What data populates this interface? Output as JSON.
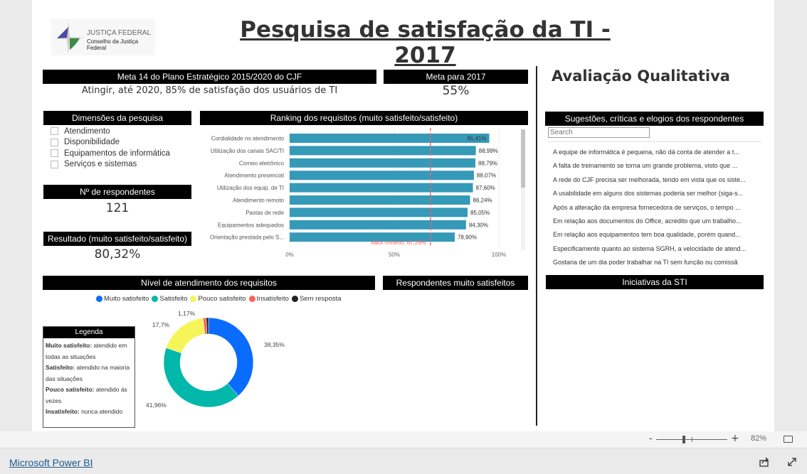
{
  "report": {
    "logo": {
      "line1": "JUSTIÇA FEDERAL",
      "line2": "Conselho da Justiça Federal"
    },
    "title": "Pesquisa de satisfação da TI - 2017",
    "meta14": {
      "header": "Meta 14 do Plano Estratégico  2015/2020 do CJF",
      "text": "Atingir, até 2020, 85% de satisfação dos usuários de TI"
    },
    "meta2017": {
      "header": "Meta para 2017",
      "value": "55%"
    },
    "dimensoes": {
      "header": "Dimensões da pesquisa",
      "items": [
        "Atendimento",
        "Disponibilidade",
        "Equipamentos de informática",
        "Serviços e sistemas"
      ]
    },
    "respondentes": {
      "header": "Nº de respondentes",
      "value": "121"
    },
    "resultado": {
      "header": "Resultado (muito satisfeito/satisfeito)",
      "value": "80,32%"
    },
    "ranking_header": "Ranking dos requisitos (muito satisfeito/satisfeito)",
    "nivel_header": "Nível de atendimento dos requisitos",
    "muito_satisfeitos_header": "Respondentes muito satisfeitos",
    "legenda": {
      "header": "Legenda",
      "items": [
        {
          "term": "Muito satisfeito:",
          "desc": " atendido em todas as situações"
        },
        {
          "term": "Satisfeito:",
          "desc": " atendido na maioria das situações"
        },
        {
          "term": "Pouco satisfeito:",
          "desc": " atendido ás vezes"
        },
        {
          "term": "Insatisfeito:",
          "desc": " nunca atendido"
        }
      ]
    },
    "qualitativa": {
      "title": "Avaliação Qualitativa",
      "header": "Sugestões, críticas e elogios dos respondentes",
      "search_placeholder": "Search",
      "comments": [
        "A equipe de informática é pequena, não dá conta de atender a t...",
        "A falta de treinamento se torna um grande problema, visto que ...",
        "A rede do CJF precisa ser melhorada, tendo em vista que os siste...",
        "A usabilidade em alguns dos sistemas poderia ser melhor (siga-s...",
        "Após a alteração da empresa fornecedora de serviços, o tempo ...",
        "Em relação aos documentos do Office, acredito que um trabalho...",
        "Em relação aos equipamentos tem boa qualidade, porém quand...",
        "Especificamente quanto ao sistema SGRH, a velocidade de atend...",
        "Gostaria de um dia poder trabalhar na TI sem função ou comissã"
      ]
    },
    "iniciativas_header": "Iniciativas da STI"
  },
  "chart_data": [
    {
      "type": "bar",
      "orientation": "horizontal",
      "categories": [
        "Cordialidade no atendimento",
        "Utilização dos canais SAC/TI",
        "Correio eletrônico",
        "Atendimento presencial",
        "Utilização dos equip. de TI",
        "Atendimento remoto",
        "Pastas de rede",
        "Equipamentos adequados",
        "Orientação prestada pelo S..."
      ],
      "values": [
        95.41,
        88.99,
        88.79,
        88.07,
        87.6,
        86.24,
        85.05,
        84.3,
        78.9
      ],
      "labels": [
        "95,41%",
        "88,99%",
        "88,79%",
        "88,07%",
        "87,60%",
        "86,24%",
        "85,05%",
        "84,30%",
        "78,90%"
      ],
      "xlim": [
        0,
        100
      ],
      "xticks": [
        "0%",
        "50%",
        "100%"
      ],
      "reference_line": {
        "value": 67.29,
        "label": "Valor mínimo: 67,29%",
        "color": "#fd625e"
      },
      "bar_color": "#3599b8",
      "grid": true
    },
    {
      "type": "pie",
      "donut": true,
      "series": [
        {
          "name": "Muito satisfeito",
          "value": 38.35,
          "label": "38,35%",
          "color": "#0a6cff"
        },
        {
          "name": "Satisfeito",
          "value": 41.96,
          "label": "41,96%",
          "color": "#01b8aa"
        },
        {
          "name": "Pouco satisfeito",
          "value": 17.7,
          "label": "17,7%",
          "color": "#f5f55a"
        },
        {
          "name": "Insatisfeito",
          "value": 1.17,
          "label": "1,17%",
          "color": "#fd625e"
        },
        {
          "name": "Sem resposta",
          "value": 0.82,
          "label": "",
          "color": "#222222"
        }
      ],
      "legend": "top"
    }
  ],
  "footer": {
    "brand": "Microsoft Power BI",
    "zoom": "82%",
    "zoom_minus": "-",
    "zoom_plus": "+",
    "zoom_level": 0.42
  }
}
